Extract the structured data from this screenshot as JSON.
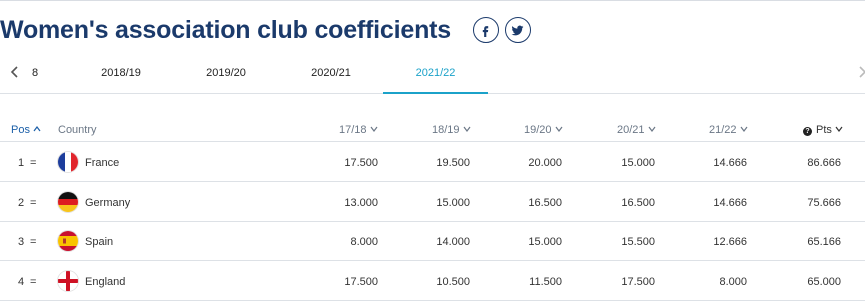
{
  "header": {
    "title": "Women's association club coefficients"
  },
  "social": [
    {
      "name": "facebook-icon"
    },
    {
      "name": "twitter-icon"
    }
  ],
  "tabs": {
    "partial_left": "8",
    "items": [
      "2018/19",
      "2019/20",
      "2020/21",
      "2021/22"
    ],
    "active": "2021/22"
  },
  "table": {
    "headers": {
      "pos": "Pos",
      "country": "Country",
      "s1": "17/18",
      "s2": "18/19",
      "s3": "19/20",
      "s4": "20/21",
      "s5": "21/22",
      "pts": "Pts"
    },
    "rows": [
      {
        "pos": "1",
        "trend": "=",
        "country": "France",
        "flag": "france-flag-icon",
        "s1": "17.500",
        "s2": "19.500",
        "s3": "20.000",
        "s4": "15.000",
        "s5": "14.666",
        "pts": "86.666"
      },
      {
        "pos": "2",
        "trend": "=",
        "country": "Germany",
        "flag": "germany-flag-icon",
        "s1": "13.000",
        "s2": "15.000",
        "s3": "16.500",
        "s4": "16.500",
        "s5": "14.666",
        "pts": "75.666"
      },
      {
        "pos": "3",
        "trend": "=",
        "country": "Spain",
        "flag": "spain-flag-icon",
        "s1": "8.000",
        "s2": "14.000",
        "s3": "15.000",
        "s4": "15.500",
        "s5": "12.666",
        "pts": "65.166"
      },
      {
        "pos": "4",
        "trend": "=",
        "country": "England",
        "flag": "england-flag-icon",
        "s1": "17.500",
        "s2": "10.500",
        "s3": "11.500",
        "s4": "17.500",
        "s5": "8.000",
        "pts": "65.000"
      }
    ]
  },
  "colors": {
    "title": "#1b3a6b",
    "accent": "#1ba2c9",
    "sort_active": "#1b5fa8",
    "border": "#dde1e6"
  }
}
